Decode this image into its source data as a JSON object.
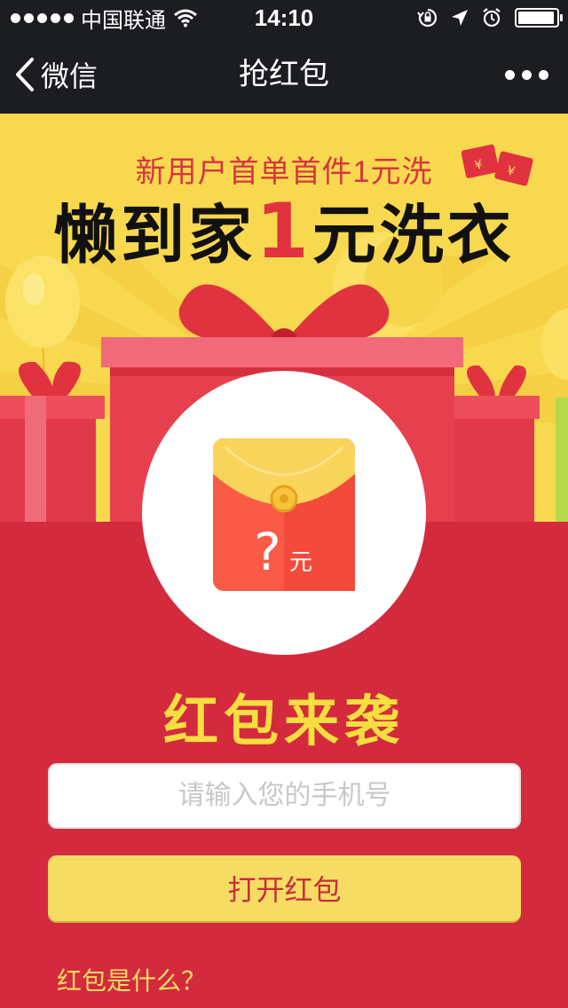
{
  "status_bar": {
    "carrier": "中国联通",
    "time": "14:10"
  },
  "nav": {
    "back_label": "微信",
    "title": "抢红包"
  },
  "banner": {
    "subtitle": "新用户首单首件1元洗",
    "headline_part1": "懒到家",
    "headline_highlight": "1",
    "headline_part2": "元洗衣",
    "coin_symbol": "¥"
  },
  "envelope": {
    "question": "?",
    "unit": "元"
  },
  "main": {
    "title": "红包来袭",
    "phone_placeholder": "请输入您的手机号",
    "phone_value": "",
    "open_button": "打开红包",
    "what_link": "红包是什么？"
  },
  "colors": {
    "nav_bg": "#1c1d21",
    "banner_yellow": "#f8d84f",
    "main_red": "#d42a3e",
    "accent_yellow": "#f5de3f",
    "button_yellow": "#f6dc63",
    "headline_red": "#e0333f"
  },
  "icons": [
    "signal-dots-icon",
    "wifi-icon",
    "rotation-lock-icon",
    "location-arrow-icon",
    "alarm-icon",
    "battery-icon",
    "back-chevron-icon",
    "more-dots-icon",
    "red-envelope-icon"
  ]
}
